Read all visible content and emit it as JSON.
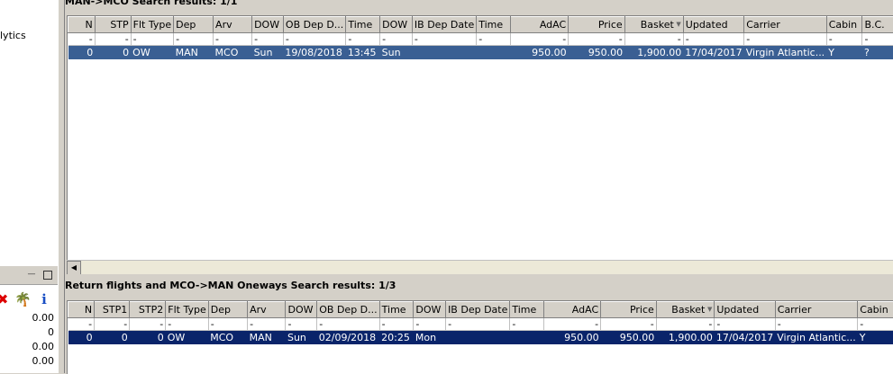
{
  "left_panel": {
    "nav_text": "lytics",
    "values": [
      "0.00",
      "0",
      "0.00",
      "0.00"
    ]
  },
  "panel1": {
    "title": "MAN->MCO Search results: 1/1",
    "columns": [
      "N",
      "STP",
      "Flt Type",
      "Dep",
      "Arv",
      "DOW",
      "OB Dep D...",
      "Time",
      "DOW",
      "IB Dep Date",
      "Time",
      "AdAC",
      "Price",
      "Basket",
      "Updated",
      "Carrier",
      "Cabin",
      "B.C."
    ],
    "filter": [
      "-",
      "-",
      "-",
      "-",
      "-",
      "-",
      "-",
      "-",
      "-",
      "-",
      "-",
      "-",
      "-",
      "-",
      "-",
      "-",
      "-",
      "-"
    ],
    "rows": [
      [
        "0",
        "0",
        "OW",
        "MAN",
        "MCO",
        "Sun",
        "19/08/2018",
        "13:45",
        "Sun",
        "",
        "",
        "950.00",
        "950.00",
        "1,900.00",
        "17/04/2017",
        "Virgin Atlantic...",
        "Y",
        "?"
      ]
    ]
  },
  "panel2": {
    "title": "Return flights and MCO->MAN Oneways Search results: 1/3",
    "columns": [
      "N",
      "STP1",
      "STP2",
      "Flt Type",
      "Dep",
      "Arv",
      "DOW",
      "OB Dep D...",
      "Time",
      "DOW",
      "IB Dep Date",
      "Time",
      "AdAC",
      "Price",
      "Basket",
      "Updated",
      "Carrier",
      "Cabin"
    ],
    "filter": [
      "-",
      "-",
      "-",
      "-",
      "-",
      "-",
      "-",
      "-",
      "-",
      "-",
      "-",
      "-",
      "-",
      "-",
      "-",
      "-",
      "-",
      "-"
    ],
    "rows": [
      [
        "0",
        "0",
        "0",
        "OW",
        "MCO",
        "MAN",
        "Sun",
        "02/09/2018",
        "20:25",
        "Mon",
        "",
        "",
        "950.00",
        "950.00",
        "1,900.00",
        "17/04/2017",
        "Virgin Atlantic...",
        "Y"
      ]
    ]
  },
  "icons": {
    "minimize": "minimize-icon",
    "maximize": "maximize-icon",
    "delete": "delete-icon",
    "palm": "palm-tree-icon",
    "info": "info-icon"
  },
  "colors": {
    "row_selected": "#0a246a",
    "row_highlight": "#3a5f93"
  }
}
